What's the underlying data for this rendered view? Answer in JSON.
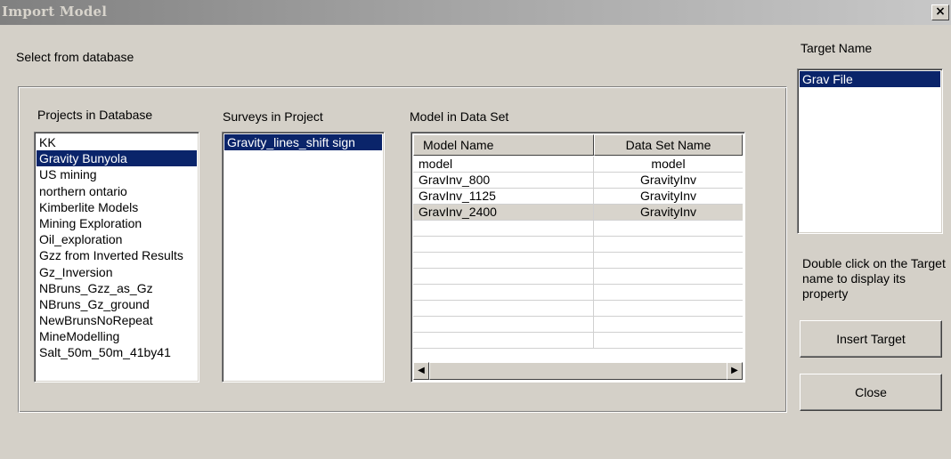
{
  "window": {
    "title": "Import Model",
    "close_glyph": "×"
  },
  "select_label": "Select from database",
  "projects": {
    "label": "Projects in Database",
    "selected_index": 1,
    "items": [
      "KK",
      "Gravity Bunyola",
      "US mining",
      "northern ontario",
      "Kimberlite Models",
      "Mining Exploration",
      "Oil_exploration",
      "Gzz from Inverted Results",
      "Gz_Inversion",
      "NBruns_Gzz_as_Gz",
      "NBruns_Gz_ground",
      "NewBrunsNoRepeat",
      "MineModelling",
      "Salt_50m_50m_41by41"
    ]
  },
  "surveys": {
    "label": "Surveys in Project",
    "selected_index": 0,
    "items": [
      "Gravity_lines_shift sign"
    ]
  },
  "models": {
    "label": "Model in Data Set",
    "columns": [
      "Model Name",
      "Data Set Name"
    ],
    "selected_index": 3,
    "rows": [
      [
        "model",
        "model"
      ],
      [
        "GravInv_800",
        "GravityInv"
      ],
      [
        "GravInv_1125",
        "GravityInv"
      ],
      [
        "GravInv_2400",
        "GravityInv"
      ],
      [
        "",
        ""
      ],
      [
        "",
        ""
      ],
      [
        "",
        ""
      ],
      [
        "",
        ""
      ],
      [
        "",
        ""
      ],
      [
        "",
        ""
      ],
      [
        "",
        ""
      ],
      [
        "",
        ""
      ]
    ],
    "scroll_left_glyph": "◀",
    "scroll_right_glyph": "▶"
  },
  "target": {
    "label": "Target Name",
    "selected_index": 0,
    "items": [
      "Grav File"
    ],
    "hint": "Double click on the Target name to display its property"
  },
  "buttons": {
    "insert_target": "Insert Target",
    "close": "Close"
  },
  "colors": {
    "face": "#d4d0c8",
    "selection": "#0a246a",
    "title_gradient_start": "#808080"
  }
}
